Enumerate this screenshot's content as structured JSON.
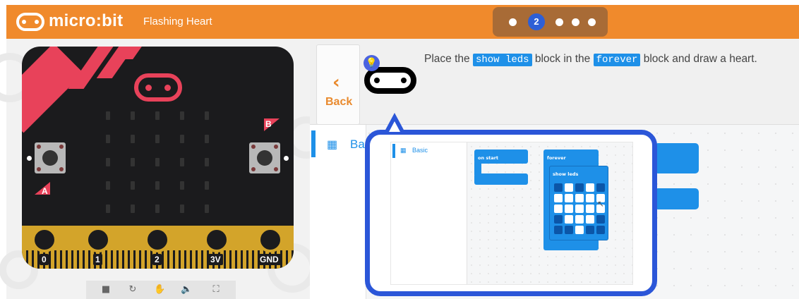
{
  "header": {
    "logo_text": "micro:bit",
    "project_title": "Flashing Heart",
    "steps": [
      {
        "label": "",
        "active": false
      },
      {
        "label": "2",
        "active": true
      },
      {
        "label": "",
        "active": false
      },
      {
        "label": "",
        "active": false
      },
      {
        "label": "",
        "active": false
      }
    ],
    "color": "#f08a2c"
  },
  "simulator": {
    "pins": [
      "0",
      "1",
      "2",
      "3V",
      "GND"
    ],
    "buttons": {
      "a": "A",
      "b": "B"
    },
    "controls": [
      {
        "name": "stop-icon",
        "glyph": "■"
      },
      {
        "name": "restart-icon",
        "glyph": "↻"
      },
      {
        "name": "slowmo-icon",
        "glyph": "✋"
      },
      {
        "name": "mute-icon",
        "glyph": "🔈"
      },
      {
        "name": "fullscreen-icon",
        "glyph": "⛶"
      }
    ]
  },
  "tutorial": {
    "back_label": "Back",
    "instruction": {
      "part1": "Place the ",
      "kw1": "show leds",
      "part2": " block in the ",
      "kw2": "forever",
      "part3": " block and draw a heart."
    },
    "hint_icon": "lightbulb-icon"
  },
  "toolbox": {
    "category": "Ba",
    "icon": "grid-icon"
  },
  "hint_image": {
    "toolbox_label": "Basic",
    "on_start_label": "on start",
    "forever_label": "forever",
    "show_leds_label": "show leds",
    "heart_grid": [
      [
        0,
        1,
        0,
        1,
        0
      ],
      [
        1,
        1,
        1,
        1,
        1
      ],
      [
        1,
        1,
        1,
        1,
        1
      ],
      [
        0,
        1,
        1,
        1,
        0
      ],
      [
        0,
        0,
        1,
        0,
        0
      ]
    ]
  },
  "colors": {
    "accent_blue": "#1e90e8",
    "hint_border": "#2b56d8",
    "board_red": "#e8425a",
    "board_gold": "#d3a42a"
  }
}
